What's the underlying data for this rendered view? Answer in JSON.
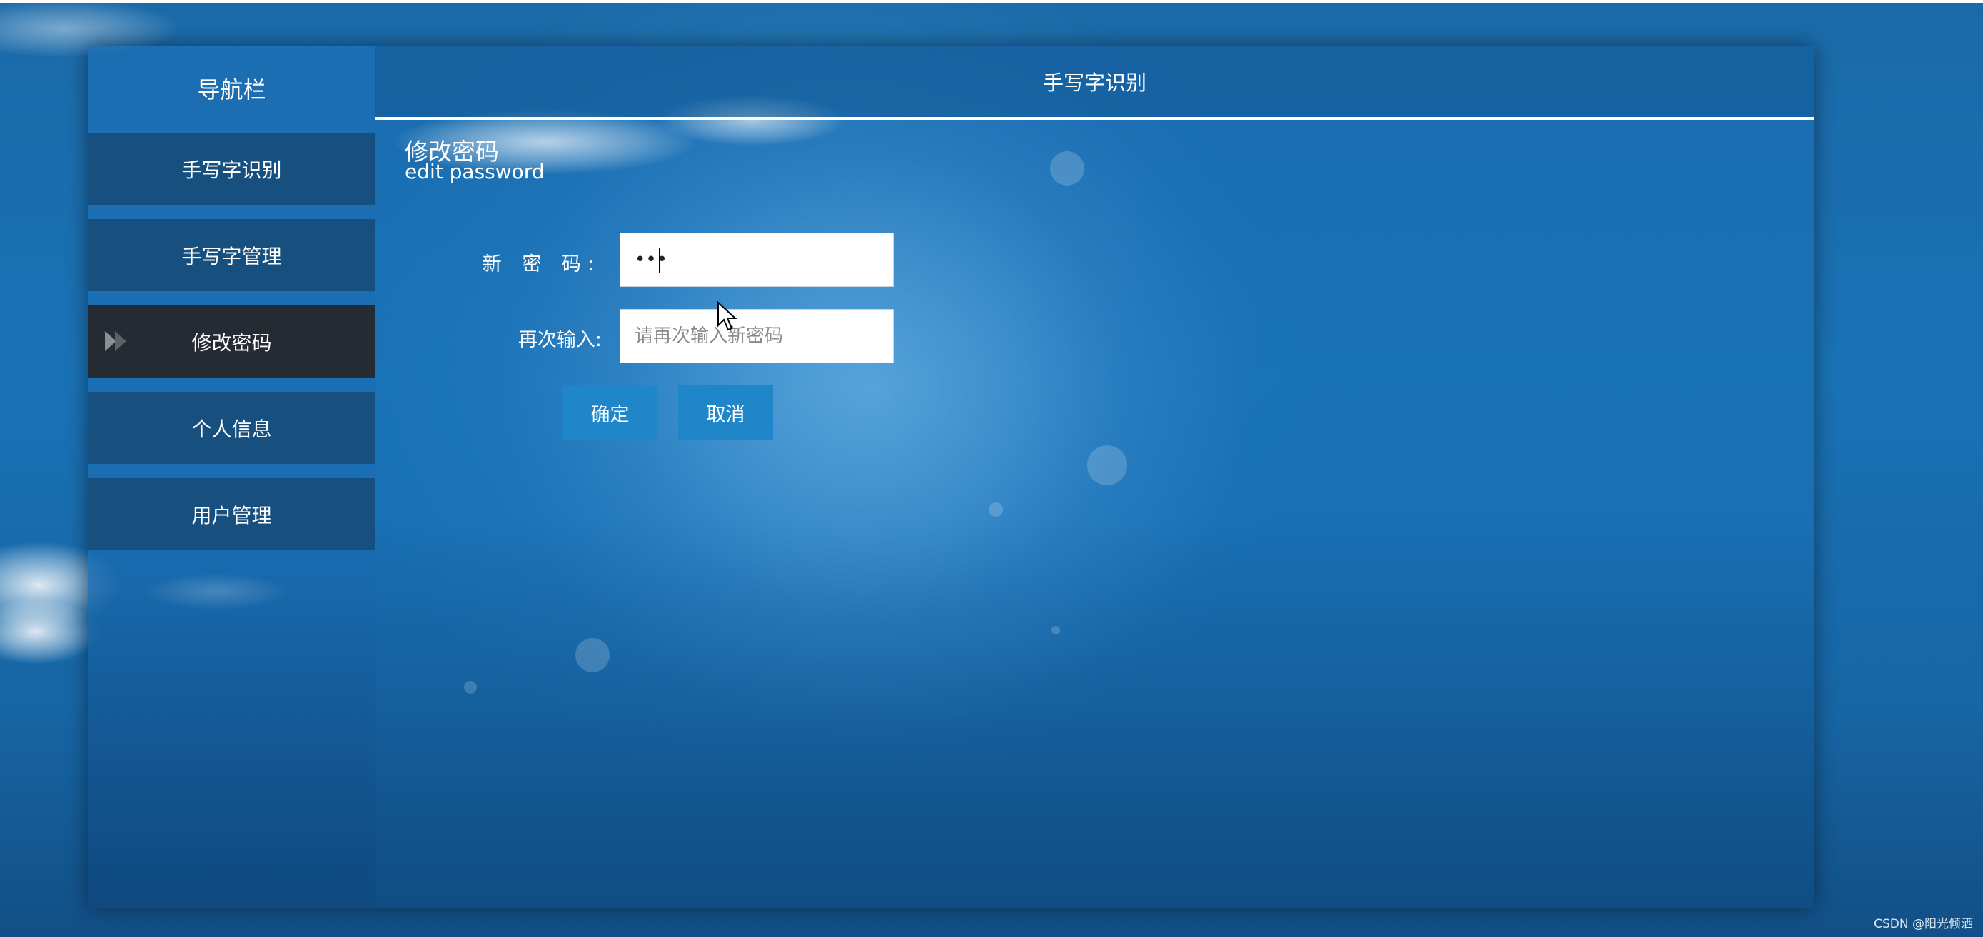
{
  "sidebar": {
    "header": "导航栏",
    "items": [
      {
        "label": "手写字识别"
      },
      {
        "label": "手写字管理"
      },
      {
        "label": "修改密码"
      },
      {
        "label": "个人信息"
      },
      {
        "label": "用户管理"
      }
    ],
    "active_index": 2
  },
  "topbar": {
    "title": "手写字识别"
  },
  "form": {
    "title_cn": "修改密码",
    "title_en": "edit password",
    "new_password_label": "新 密 码:",
    "new_password_value": "•••",
    "confirm_label": "再次输入:",
    "confirm_placeholder": "请再次输入新密码",
    "ok_label": "确定",
    "cancel_label": "取消"
  },
  "watermark": "CSDN @阳光倾洒",
  "colors": {
    "nav_item": "#174f7e",
    "nav_active": "#252b33",
    "button": "#1f86c9",
    "background": "#1a72b5"
  }
}
